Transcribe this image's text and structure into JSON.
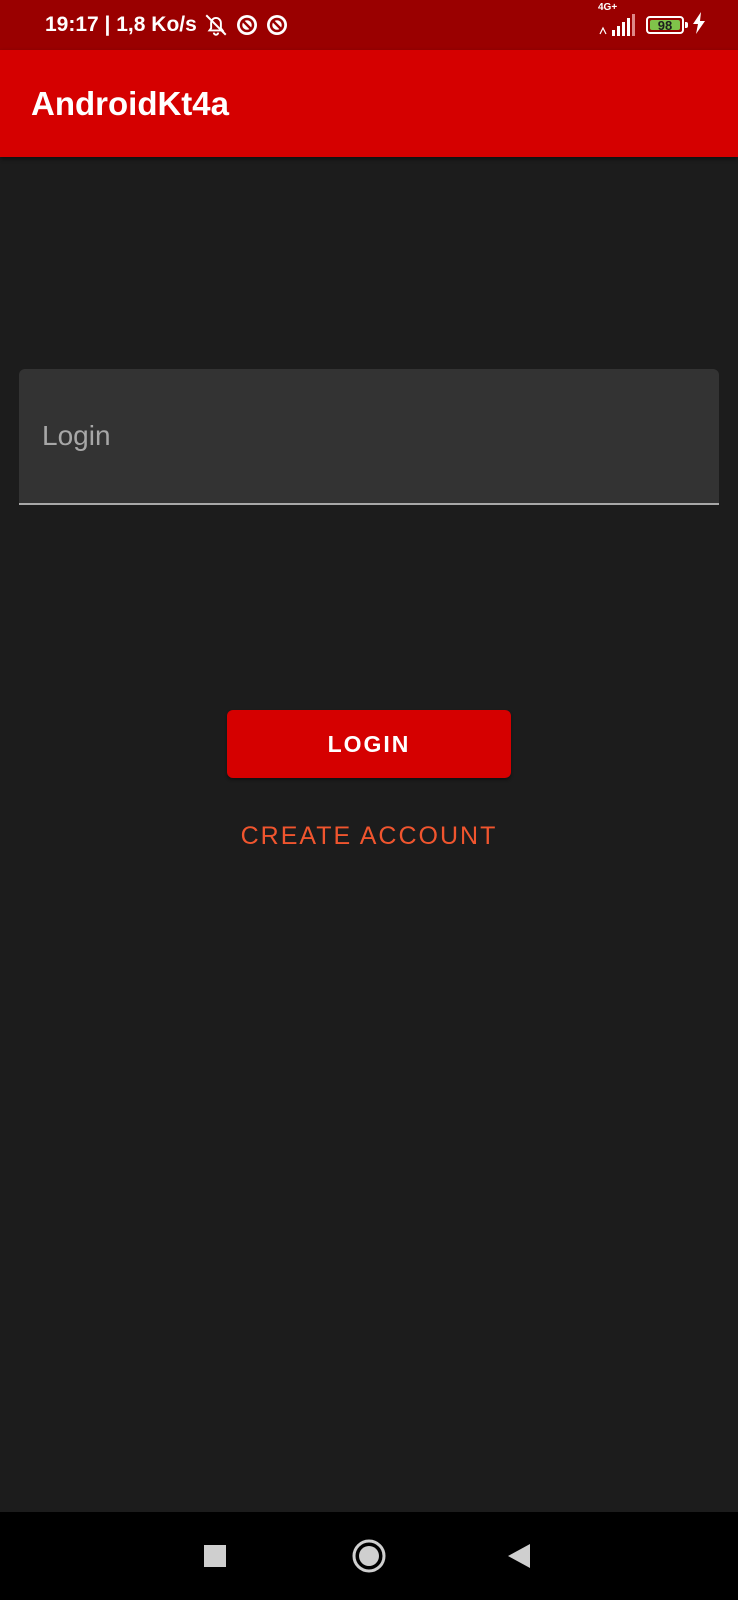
{
  "status_bar": {
    "time_and_speed": "19:17 | 1,8 Ko/s",
    "network_type": "4G+",
    "battery_level": "98",
    "colors": {
      "background": "#9a0000",
      "battery_fill": "#7fc34a"
    },
    "icons": [
      "bell-off-icon",
      "target-app-icon",
      "target-app-icon",
      "signal-icon",
      "battery-icon",
      "charging-bolt-icon"
    ]
  },
  "app_bar": {
    "title": "AndroidKt4a",
    "color": "#d50000"
  },
  "login_form": {
    "login_placeholder": "Login",
    "login_value": "",
    "login_button_label": "LOGIN",
    "create_account_label": "CREATE ACCOUNT",
    "accent_color": "#f0552e"
  },
  "nav_bar": {
    "buttons": [
      "recents-icon",
      "home-icon",
      "back-icon"
    ]
  }
}
